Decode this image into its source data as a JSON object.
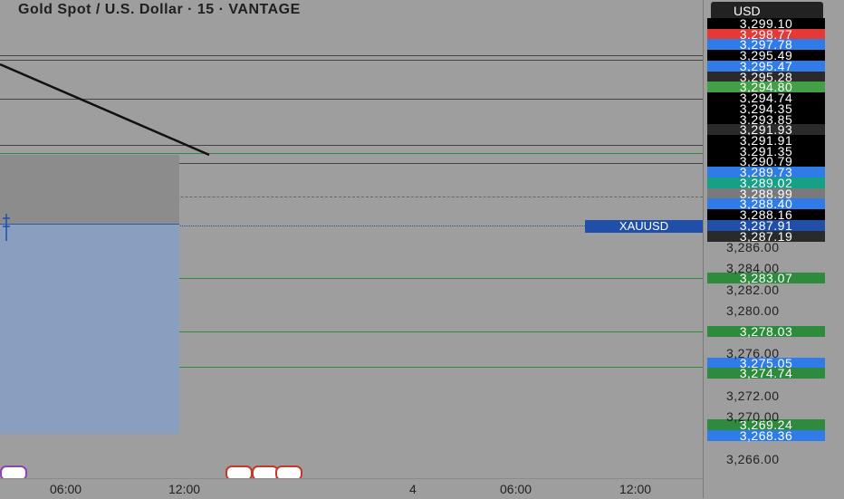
{
  "header": {
    "title": "Gold Spot / U.S. Dollar · 15 · VANTAGE"
  },
  "axis": {
    "currency": "USD",
    "price_labels": [
      {
        "value": "3,299.10",
        "color": "#000000"
      },
      {
        "value": "3,298.77",
        "color": "#e53935"
      },
      {
        "value": "3,297.78",
        "color": "#2f7be8"
      },
      {
        "value": "3,295.49",
        "color": "#000000"
      },
      {
        "value": "3,295.47",
        "color": "#2f7be8"
      },
      {
        "value": "3,295.28",
        "color": "#2a2a2a"
      },
      {
        "value": "3,294.80",
        "color": "#43a047"
      },
      {
        "value": "3,294.74",
        "color": "#000000"
      },
      {
        "value": "3,294.35",
        "color": "#000000"
      },
      {
        "value": "3,293.85",
        "color": "#000000"
      },
      {
        "value": "3,291.93",
        "color": "#2a2a2a"
      },
      {
        "value": "3,291.91",
        "color": "#000000"
      },
      {
        "value": "3,291.35",
        "color": "#000000"
      },
      {
        "value": "3,290.79",
        "color": "#000000"
      },
      {
        "value": "3,289.73",
        "color": "#2f7be8"
      },
      {
        "value": "3,289.02",
        "color": "#16a085"
      },
      {
        "value": "3,288.99",
        "color": "#7a7a7a"
      },
      {
        "value": "3,288.40",
        "color": "#2f7be8"
      },
      {
        "value": "3,288.16",
        "color": "#000000"
      },
      {
        "value": "3,287.91",
        "color": "#1f4fa8"
      },
      {
        "value": "3,287.19",
        "color": "#2a2a2a"
      },
      {
        "value": "3,283.07",
        "color": "#2e8b3e"
      },
      {
        "value": "3,278.03",
        "color": "#2e8b3e"
      },
      {
        "value": "3,275.05",
        "color": "#2f7be8"
      },
      {
        "value": "3,274.74",
        "color": "#2e8b3e"
      },
      {
        "value": "3,269.24",
        "color": "#2e8b3e"
      },
      {
        "value": "3,268.36",
        "color": "#2f7be8"
      }
    ],
    "ticks": [
      "3,286.00",
      "3,284.00",
      "3,282.00",
      "3,280.00",
      "3,276.00",
      "3,272.00",
      "3,270.00",
      "3,266.00"
    ]
  },
  "symbol_tag": "XAUUSD",
  "time_axis": [
    "06:00",
    "12:00",
    "4",
    "06:00",
    "12:00"
  ]
}
